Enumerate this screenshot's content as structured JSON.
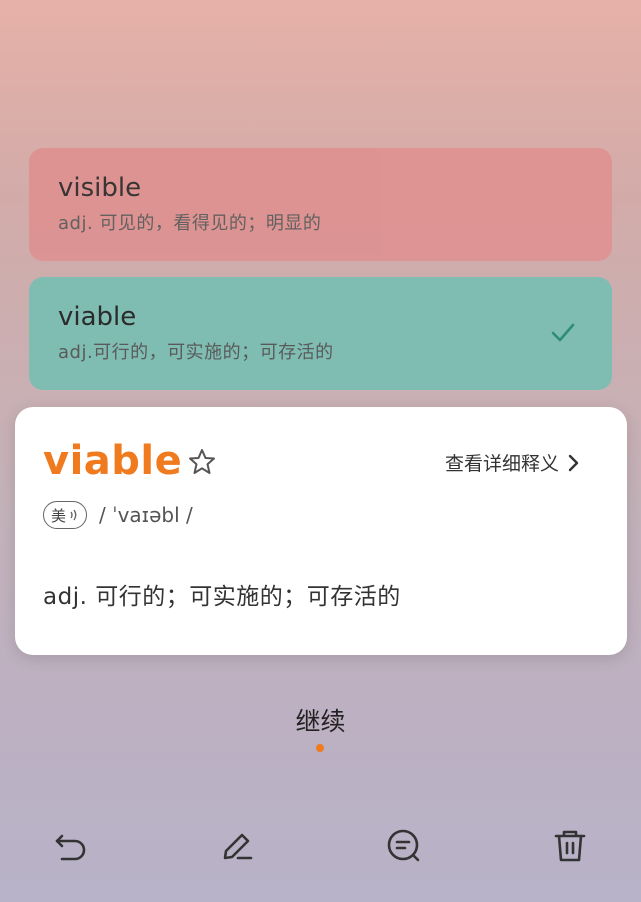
{
  "options": [
    {
      "word": "visible",
      "definition": "adj. 可见的，看得见的；明显的",
      "state": "wrong"
    },
    {
      "word": "viable",
      "definition": "adj.可行的，可实施的；可存活的",
      "state": "correct"
    }
  ],
  "card": {
    "word": "viable",
    "detail_link": "查看详细释义",
    "region": "美",
    "phonetic": "/ ˈvaɪəbl /",
    "meaning": "adj. 可行的；可实施的；可存活的"
  },
  "continue_label": "继续",
  "toolbar": {
    "icons": [
      "undo-icon",
      "edit-icon",
      "comment-icon",
      "trash-icon"
    ]
  },
  "colors": {
    "accent": "#f07a1e",
    "wrong_bg": "#de9191",
    "correct_bg": "#7fbdb2",
    "check": "#2e8c7b"
  }
}
